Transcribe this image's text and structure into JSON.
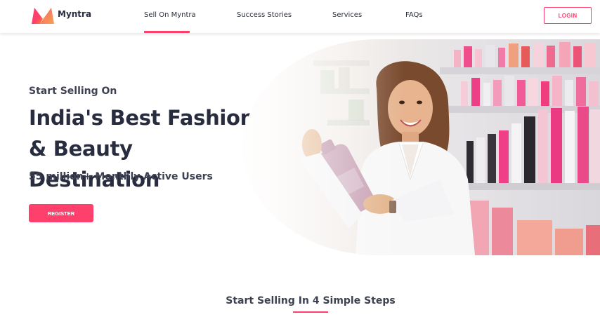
{
  "header": {
    "brand": "Myntra",
    "nav": [
      {
        "label": "Sell On Myntra",
        "active": true
      },
      {
        "label": "Success Stories",
        "active": false
      },
      {
        "label": "Services",
        "active": false
      },
      {
        "label": "FAQs",
        "active": false
      }
    ],
    "login_label": "LOGIN"
  },
  "hero": {
    "subtitle": "Start Selling On",
    "title": "India's Best Fashion & Beauty Destination",
    "users": "55 million+ Monthly Active Users",
    "register_label": "REGISTER",
    "image_icon": "seller-with-product-photo"
  },
  "steps": {
    "title": "Start Selling In 4 Simple Steps"
  },
  "colors": {
    "accent": "#ff3f6c",
    "text_dark": "#282c3f",
    "text_muted": "#3e4152"
  }
}
